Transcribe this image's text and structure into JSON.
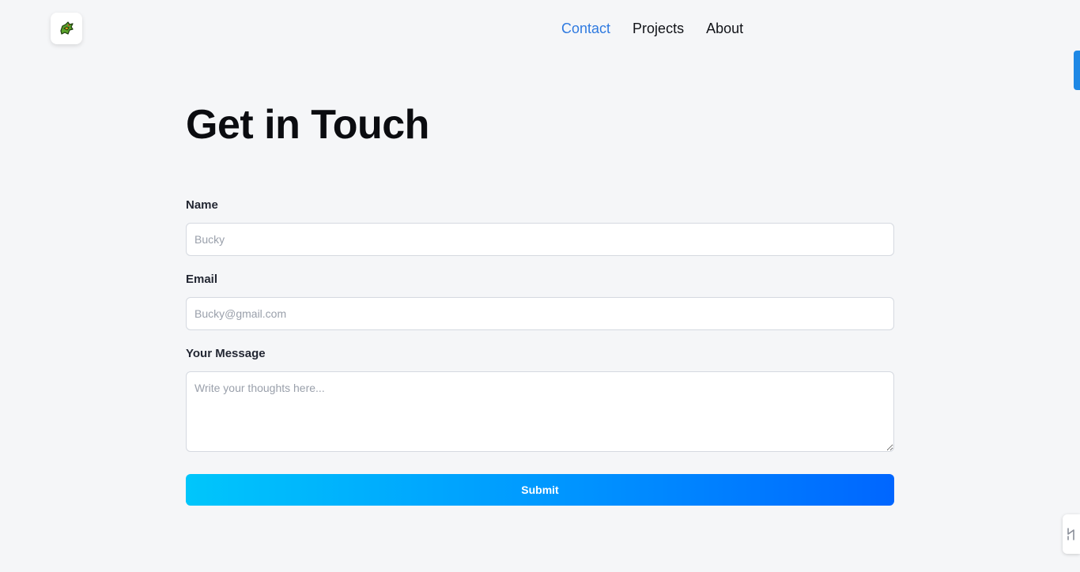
{
  "header": {
    "logo_icon": "dragon-logo-icon",
    "nav": [
      {
        "label": "Contact",
        "active": true
      },
      {
        "label": "Projects",
        "active": false
      },
      {
        "label": "About",
        "active": false
      }
    ]
  },
  "main": {
    "title": "Get in Touch",
    "form": {
      "name_label": "Name",
      "name_placeholder": "Bucky",
      "email_label": "Email",
      "email_placeholder": "Bucky@gmail.com",
      "message_label": "Your Message",
      "message_placeholder": "Write your thoughts here...",
      "submit_label": "Submit"
    }
  },
  "colors": {
    "background": "#f5f6f8",
    "nav_active": "#2f7ae0",
    "submit_gradient_start": "#00c6fb",
    "submit_gradient_end": "#0066ff"
  },
  "edge": {
    "widget_icon": "pen-tool-icon"
  }
}
